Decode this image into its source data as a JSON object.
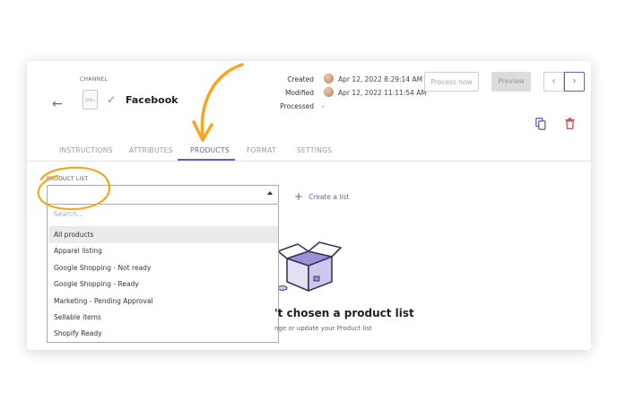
{
  "header": {
    "back_glyph": "←",
    "channel_label": "CHANNEL",
    "file_icon_text": "(URL)",
    "check_glyph": "✓",
    "channel_name": "Facebook",
    "meta": [
      {
        "label": "Created",
        "value": "Apr 12, 2022 8:29:14 AM",
        "has_avatar": true
      },
      {
        "label": "Modified",
        "value": "Apr 12, 2022 11:11:54 AM",
        "has_avatar": true
      },
      {
        "label": "Processed",
        "value": "-",
        "has_avatar": false
      }
    ],
    "process_label": "Process now",
    "preview_label": "Preview",
    "prev_glyph": "‹",
    "next_glyph": "›"
  },
  "tabs": [
    {
      "label": "INSTRUCTIONS",
      "active": false
    },
    {
      "label": "ATTRIBUTES",
      "active": false
    },
    {
      "label": "PRODUCTS",
      "active": true
    },
    {
      "label": "FORMAT",
      "active": false
    },
    {
      "label": "SETTINGS",
      "active": false
    }
  ],
  "product_list": {
    "label": "PRODUCT LIST",
    "value": "",
    "create_glyph": "+",
    "create_label": "Create a list",
    "search_placeholder": "Search...",
    "options": [
      {
        "label": "All products",
        "selected": true
      },
      {
        "label": "Apparel listing",
        "selected": false
      },
      {
        "label": "Google Shopping - Not ready",
        "selected": false
      },
      {
        "label": "Google Shopping - Ready",
        "selected": false
      },
      {
        "label": "Marketing - Pending Approval",
        "selected": false
      },
      {
        "label": "Sellable items",
        "selected": false
      },
      {
        "label": "Shopify Ready",
        "selected": false
      }
    ]
  },
  "empty_state": {
    "title": "'t chosen a product list",
    "subtitle": "nge or update your Product list"
  },
  "colors": {
    "accent": "#6b5fb3",
    "annotation": "#f5a623",
    "delete": "#e0474c",
    "check": "#3aa0d8"
  }
}
